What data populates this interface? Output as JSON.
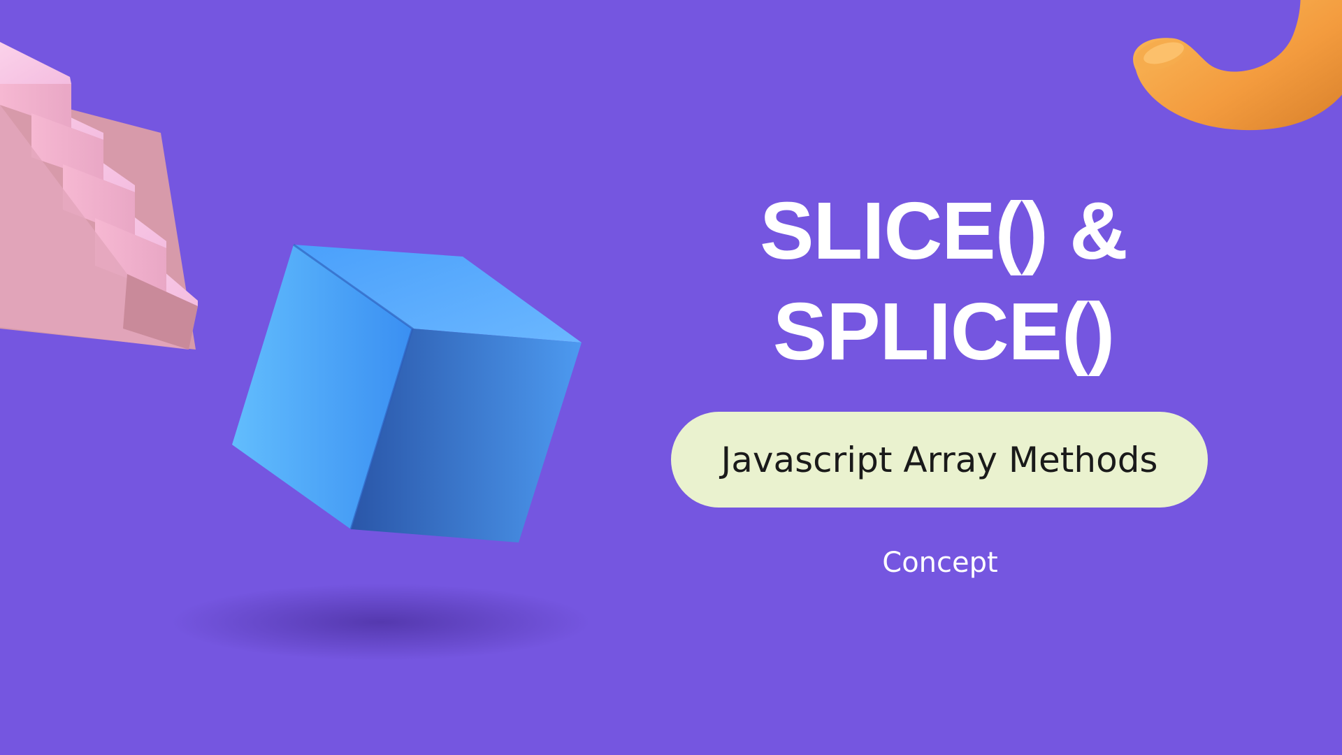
{
  "slide": {
    "title_line1": "SLICE() & ",
    "title_line2": "SPLICE()",
    "pill_label": "Javascript Array Methods",
    "subtitle": "Concept"
  },
  "colors": {
    "background": "#7556e0",
    "pill": "#eaf2cf",
    "cube": "#3f8ff0",
    "stairs": "#f2b6d6",
    "torus": "#f2a24a"
  },
  "icons": [
    "pink-stairs-icon",
    "blue-cube-icon",
    "orange-torus-icon"
  ]
}
